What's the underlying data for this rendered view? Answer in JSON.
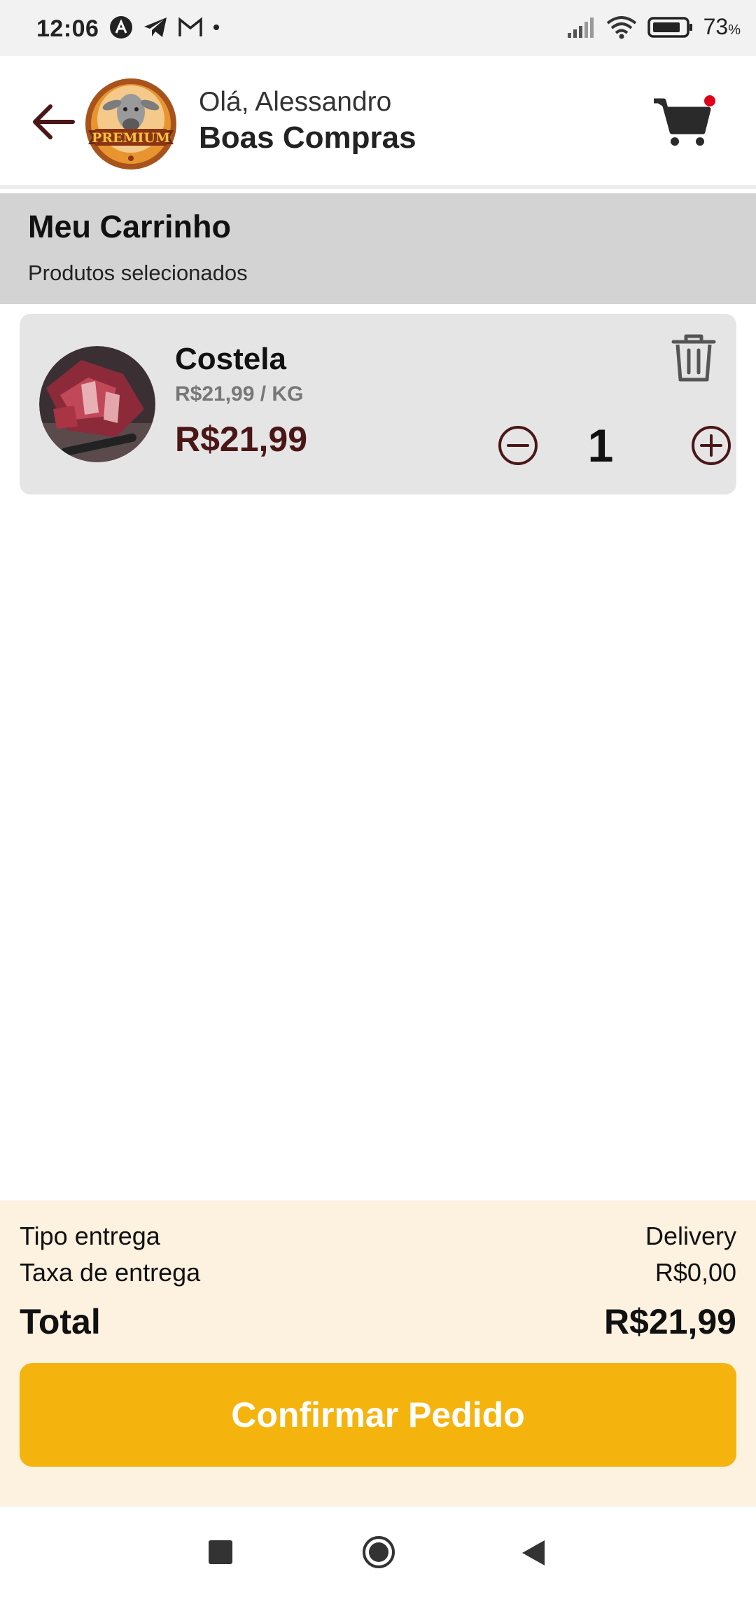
{
  "status_bar": {
    "time": "12:06",
    "battery_percent": "73",
    "battery_unit": "%",
    "icons": [
      "app-a-icon",
      "telegram-icon",
      "gmail-icon",
      "dot-icon",
      "signal-icon",
      "wifi-icon",
      "battery-icon"
    ]
  },
  "header": {
    "greeting": "Olá, Alessandro",
    "shop_name": "Boas Compras",
    "logo_text": "PREMIUM",
    "cart_has_notification": true
  },
  "section": {
    "title": "Meu Carrinho",
    "subtitle": "Produtos selecionados"
  },
  "cart": {
    "items": [
      {
        "name": "Costela",
        "unit_price": "R$21,99 / KG",
        "price": "R$21,99",
        "quantity": "1"
      }
    ]
  },
  "summary": {
    "delivery_type_label": "Tipo entrega",
    "delivery_type_value": "Delivery",
    "delivery_fee_label": "Taxa de entrega",
    "delivery_fee_value": "R$0,00",
    "total_label": "Total",
    "total_value": "R$21,99",
    "confirm_label": "Confirmar Pedido"
  },
  "colors": {
    "accent_dark": "#4a1616",
    "confirm_button": "#f5b30e",
    "summary_bg": "#fdf1e0",
    "section_bg": "#d3d3d3",
    "item_bg": "#e5e5e5",
    "notification_dot": "#e0001b"
  }
}
